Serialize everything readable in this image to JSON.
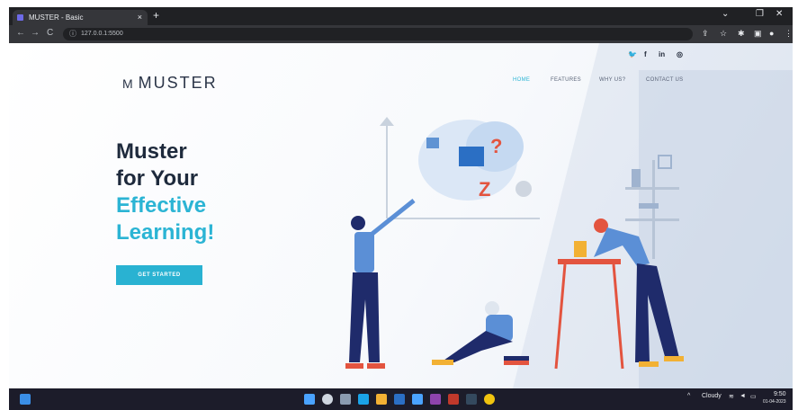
{
  "browser": {
    "tab_title": "MUSTER - Basic",
    "tab_close": "×",
    "new_tab": "+",
    "url": "127.0.0.1:5500",
    "nav_back": "←",
    "nav_forward": "→",
    "nav_reload": "C",
    "window_minimize": "⌄",
    "window_maximize": "❐",
    "window_close": "✕"
  },
  "site": {
    "social": {
      "twitter": "🐦",
      "facebook": "f",
      "linkedin": "in",
      "instagram": "◎"
    },
    "logo": {
      "mark": "M",
      "text": "MUSTER"
    },
    "nav": {
      "home": "HOME",
      "features": "FEATURES",
      "why_us": "WHY US?",
      "contact": "CONTACT US"
    },
    "hero": {
      "line1": "Muster",
      "line2": "for Your",
      "line3": "Effective",
      "line4": "Learning!",
      "cta": "GET STARTED"
    }
  },
  "taskbar": {
    "weather": "Cloudy",
    "time": "9:50",
    "date": "01-04-2023"
  },
  "colors": {
    "accent": "#2bb4d4",
    "heading": "#1e2a3c",
    "figure_blue": "#1f2b6b",
    "figure_shirt": "#5b8fd6",
    "figure_red": "#e3543f",
    "figure_yellow": "#f2b134"
  }
}
